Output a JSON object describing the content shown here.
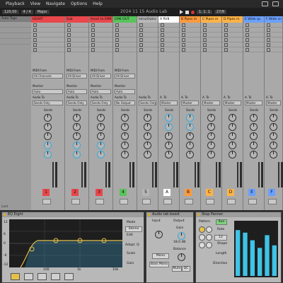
{
  "menubar": {
    "items": [
      "Playback",
      "View",
      "Navigate",
      "Options",
      "Help"
    ]
  },
  "transport": {
    "title": "2024 11 15 Audio Lab",
    "tempo": "120.00",
    "sig": "4 / 4",
    "pos": "1.  1.  1",
    "bars": "6. 0. 0",
    "key": "Major",
    "right": "27/8"
  },
  "browser": {
    "header": "Auto Tags",
    "footer": "Lost"
  },
  "tracks": [
    {
      "name": "HEART",
      "color": "#e8474b",
      "input": "All Channels",
      "monitor": "Auto",
      "out": "Sends Only",
      "num": "1"
    },
    {
      "name": "Sub",
      "color": "#e8474b",
      "input": "All Driver",
      "monitor": "Auto",
      "out": "Sends Only",
      "num": "2"
    },
    {
      "name": "Heart to EMK",
      "color": "#e8474b",
      "input": "All Driver",
      "monitor": "Auto",
      "out": "Sends Only",
      "num": "3"
    },
    {
      "name": "EMK OUT",
      "color": "#58c35a",
      "input": "All Driver",
      "monitor": "Auto",
      "out": "No Output",
      "num": "4"
    },
    {
      "name": "Intro/Outro",
      "color": "#b6b6b6",
      "input": "",
      "monitor": "",
      "out": "Sends Only",
      "num": "5"
    },
    {
      "name": "A RV8",
      "color": "#ffffff",
      "input": "",
      "monitor": "",
      "out": "Master",
      "num": "A"
    },
    {
      "name": "B Pipes m",
      "color": "#ff9a3c",
      "input": "",
      "monitor": "",
      "out": "Master",
      "num": "B"
    },
    {
      "name": "C Pipes m",
      "color": "#ffb347",
      "input": "",
      "monitor": "",
      "out": "Master",
      "num": "C"
    },
    {
      "name": "D Pipes m",
      "color": "#ffb347",
      "input": "",
      "monitor": "",
      "out": "Master",
      "num": "D"
    },
    {
      "name": "E Wide sp",
      "color": "#6aa0ff",
      "input": "",
      "monitor": "",
      "out": "Master",
      "num": "E"
    },
    {
      "name": "F Wide sn",
      "color": "#6aa0ff",
      "input": "",
      "monitor": "",
      "out": "Master",
      "num": "F"
    }
  ],
  "labels": {
    "midi_from": "MIDI From",
    "midi_to": "MIDI To",
    "monitor": "Monitor",
    "audio_to": "Audio To",
    "sends": "Sends",
    "ato": "A. To"
  },
  "devices": {
    "eq": {
      "title": "EQ Eight",
      "mode": "Mode",
      "stereo": "Stereo",
      "edit": "Edit",
      "adapt": "Adapt. Q",
      "scale": "Scale",
      "gain": "Gain",
      "y1": "12",
      "y2": "6",
      "y3": "0",
      "y4": "-6",
      "y5": "-12",
      "f1": "100",
      "f2": "1k",
      "f3": "10k"
    },
    "util": {
      "title": "Audio lab boost",
      "input": "Input",
      "output": "Output",
      "gain": "Gain",
      "gain_val": "18.0 dB",
      "balance": "Balance",
      "mono": "Mono",
      "bass_mono": "Bass Mono",
      "mute": "Mute",
      "dc": "DC"
    },
    "step": {
      "title": "Step Panner",
      "pattern": "Pattern",
      "run": "Run",
      "rate": "Rate",
      "shape": "Shape",
      "length": "Length",
      "direction": "Direction",
      "val": "12",
      "steps": [
        0.9,
        0.85,
        0.7,
        0.55,
        0.8,
        0.6
      ]
    }
  }
}
